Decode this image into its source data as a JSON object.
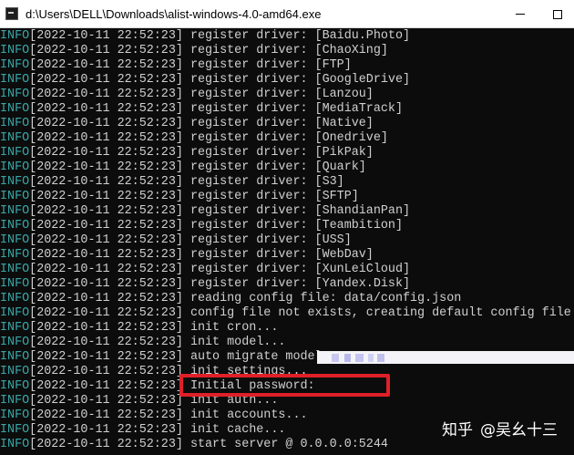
{
  "window": {
    "icon": "console-app-icon",
    "title": "d:\\Users\\DELL\\Downloads\\alist-windows-4.0-amd64.exe"
  },
  "console": {
    "lines": [
      {
        "level": "INFO",
        "ts": "[2022-10-11 22:52:23]",
        "msg": " register driver: [Baidu.Photo]"
      },
      {
        "level": "INFO",
        "ts": "[2022-10-11 22:52:23]",
        "msg": " register driver: [ChaoXing]"
      },
      {
        "level": "INFO",
        "ts": "[2022-10-11 22:52:23]",
        "msg": " register driver: [FTP]"
      },
      {
        "level": "INFO",
        "ts": "[2022-10-11 22:52:23]",
        "msg": " register driver: [GoogleDrive]"
      },
      {
        "level": "INFO",
        "ts": "[2022-10-11 22:52:23]",
        "msg": " register driver: [Lanzou]"
      },
      {
        "level": "INFO",
        "ts": "[2022-10-11 22:52:23]",
        "msg": " register driver: [MediaTrack]"
      },
      {
        "level": "INFO",
        "ts": "[2022-10-11 22:52:23]",
        "msg": " register driver: [Native]"
      },
      {
        "level": "INFO",
        "ts": "[2022-10-11 22:52:23]",
        "msg": " register driver: [Onedrive]"
      },
      {
        "level": "INFO",
        "ts": "[2022-10-11 22:52:23]",
        "msg": " register driver: [PikPak]"
      },
      {
        "level": "INFO",
        "ts": "[2022-10-11 22:52:23]",
        "msg": " register driver: [Quark]"
      },
      {
        "level": "INFO",
        "ts": "[2022-10-11 22:52:23]",
        "msg": " register driver: [S3]"
      },
      {
        "level": "INFO",
        "ts": "[2022-10-11 22:52:23]",
        "msg": " register driver: [SFTP]"
      },
      {
        "level": "INFO",
        "ts": "[2022-10-11 22:52:23]",
        "msg": " register driver: [ShandianPan]"
      },
      {
        "level": "INFO",
        "ts": "[2022-10-11 22:52:23]",
        "msg": " register driver: [Teambition]"
      },
      {
        "level": "INFO",
        "ts": "[2022-10-11 22:52:23]",
        "msg": " register driver: [USS]"
      },
      {
        "level": "INFO",
        "ts": "[2022-10-11 22:52:23]",
        "msg": " register driver: [WebDav]"
      },
      {
        "level": "INFO",
        "ts": "[2022-10-11 22:52:23]",
        "msg": " register driver: [XunLeiCloud]"
      },
      {
        "level": "INFO",
        "ts": "[2022-10-11 22:52:23]",
        "msg": " register driver: [Yandex.Disk]"
      },
      {
        "level": "INFO",
        "ts": "[2022-10-11 22:52:23]",
        "msg": " reading config file: data/config.json"
      },
      {
        "level": "INFO",
        "ts": "[2022-10-11 22:52:23]",
        "msg": " config file not exists, creating default config file"
      },
      {
        "level": "INFO",
        "ts": "[2022-10-11 22:52:23]",
        "msg": " init cron..."
      },
      {
        "level": "INFO",
        "ts": "[2022-10-11 22:52:23]",
        "msg": " init model..."
      },
      {
        "level": "INFO",
        "ts": "[2022-10-11 22:52:23]",
        "msg": " auto migrate model..."
      },
      {
        "level": "INFO",
        "ts": "[2022-10-11 22:52:23]",
        "msg": " init settings..."
      },
      {
        "level": "INFO",
        "ts": "[2022-10-11 22:52:23]",
        "msg": " Initial password:"
      },
      {
        "level": "INFO",
        "ts": "[2022-10-11 22:52:23]",
        "msg": " init auth..."
      },
      {
        "level": "INFO",
        "ts": "[2022-10-11 22:52:23]",
        "msg": " init accounts..."
      },
      {
        "level": "INFO",
        "ts": "[2022-10-11 22:52:23]",
        "msg": " init cache..."
      },
      {
        "level": "INFO",
        "ts": "[2022-10-11 22:52:23]",
        "msg": " start server @ 0.0.0.0:5244"
      }
    ]
  },
  "colors": {
    "console_bg": "#0c0c0c",
    "console_text": "#d0d0d0",
    "info_level": "#3aa6a6",
    "highlight": "#e02028"
  },
  "watermark": {
    "site": "知乎",
    "author": "@吴幺十三"
  }
}
